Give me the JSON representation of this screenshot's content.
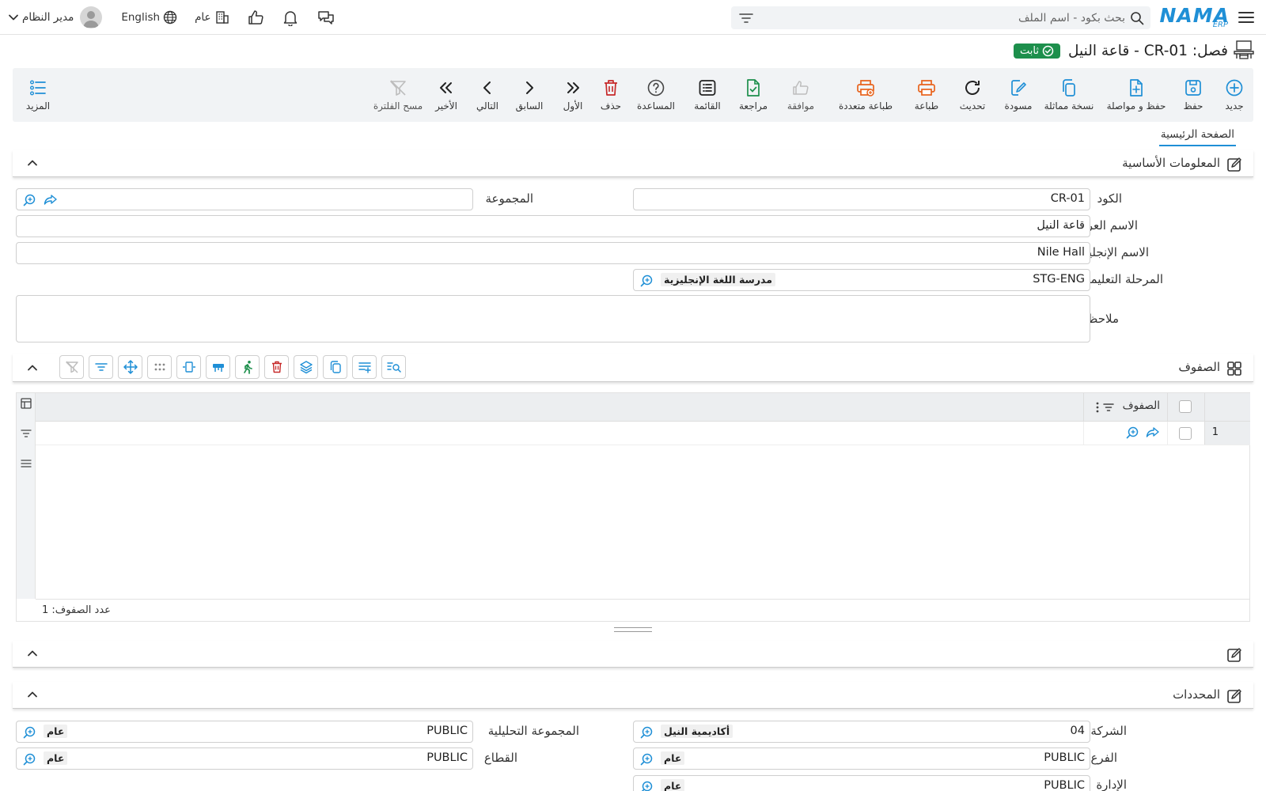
{
  "topbar": {
    "logo_main": "NAMA",
    "logo_sub": "ERP",
    "search_placeholder": "بحث بكود - اسم الملف",
    "language": "English",
    "company": "عام",
    "user": "مدير النظام"
  },
  "page": {
    "title": "فصل: CR-01 - قاعة النيل",
    "status": "ثابت",
    "status_color": "#1d8f4c",
    "accent": "#1f8fd6"
  },
  "toolbar": {
    "new": "جديد",
    "save": "حفظ",
    "save_continue": "حفظ و مواصلة",
    "duplicate": "نسخة مماثلة",
    "draft": "مسودة",
    "refresh": "تحديث",
    "print": "طباعة",
    "multi_print": "طباعة متعددة",
    "approve": "موافقة",
    "review": "مراجعة",
    "list": "القائمة",
    "help": "المساعدة",
    "delete": "حذف",
    "first": "الأول",
    "previous": "السابق",
    "next": "التالي",
    "last": "الأخير",
    "clear_filter": "مسح الفلترة",
    "more": "المزيد"
  },
  "tabs": {
    "main": "الصفحة الرئيسية"
  },
  "basic": {
    "title": "المعلومات الأساسية",
    "code_label": "الكود",
    "code_value": "CR-01",
    "group_label": "المجموعة",
    "group_value": "",
    "arabic_name_label": "الاسم العربي",
    "arabic_name_value": "قاعة النيل",
    "english_name_label": "الاسم الإنجليزي",
    "english_name_value": "Nile Hall",
    "stage_label": "المرحلة التعليمية",
    "stage_code": "STG-ENG",
    "stage_name": "مدرسة اللغة الإنجليزية",
    "notes_label": "ملاحظات",
    "notes_value": ""
  },
  "rows_section": {
    "title": "الصفوف",
    "column": "الصفوف",
    "row_number": "1",
    "count_text": "عدد الصفوف: 1"
  },
  "determinants": {
    "title": "المحددات",
    "company_label": "الشركة",
    "company_code": "04",
    "company_name": "أكاديمية النيل",
    "analysis_group_label": "المجموعة التحليلية",
    "analysis_group_code": "PUBLIC",
    "analysis_group_name": "عام",
    "branch_label": "الفرع",
    "branch_code": "PUBLIC",
    "branch_name": "عام",
    "sector_label": "القطاع",
    "sector_code": "PUBLIC",
    "sector_name": "عام",
    "department_label": "الإدارة",
    "department_code": "PUBLIC",
    "department_name": "عام"
  }
}
